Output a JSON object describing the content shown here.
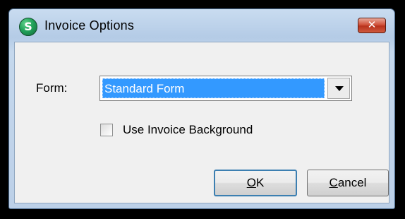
{
  "window": {
    "title": "Invoice Options",
    "icon_letter": "S",
    "close_glyph": "✕"
  },
  "form": {
    "label": "Form:",
    "selected": "Standard Form"
  },
  "background_option": {
    "label": "Use Invoice Background",
    "checked": false
  },
  "buttons": {
    "ok_first": "O",
    "ok_rest": "K",
    "cancel_first": "C",
    "cancel_rest": "ancel"
  },
  "icons": {
    "app": "app-logo-icon",
    "close": "close-icon",
    "dropdown": "chevron-down-icon"
  },
  "colors": {
    "selection": "#3399ff",
    "close_button": "#c9462c",
    "default_button_border": "#3c7fb1"
  }
}
